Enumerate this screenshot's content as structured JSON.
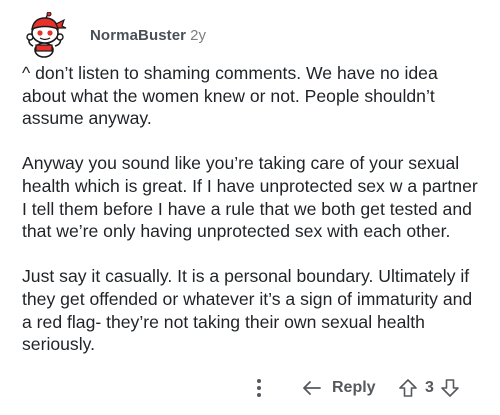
{
  "comment": {
    "avatar": {
      "icon": "snoo-avatar-icon",
      "colors": {
        "bandana": "#e8312a",
        "face": "#ffffff",
        "outline": "#1a1a1b"
      }
    },
    "author": "NormaBuster",
    "age": "2y",
    "paragraphs": [
      "^ don’t listen to shaming comments. We have no idea about what the women knew or not. People shouldn’t assume anyway.",
      "Anyway you sound like you’re taking care of your sexual health which is great. If I have unprotected sex w a partner I tell them before I have a rule that we both get tested and that we’re only having unprotected sex with each other.",
      "Just say it casually. It is a personal boundary. Ultimately if they get offended or whatever it’s a sign of immaturity and a red flag- they’re not taking their own sexual health seriously."
    ]
  },
  "actions": {
    "more_icon": "more-vertical-icon",
    "reply_icon": "reply-arrow-icon",
    "reply_label": "Reply",
    "upvote_icon": "upvote-arrow-icon",
    "score": "3",
    "downvote_icon": "downvote-arrow-icon"
  },
  "colors": {
    "text": "#1f2327",
    "meta": "#7c7f82",
    "username": "#4a5057",
    "action": "#55595e"
  }
}
